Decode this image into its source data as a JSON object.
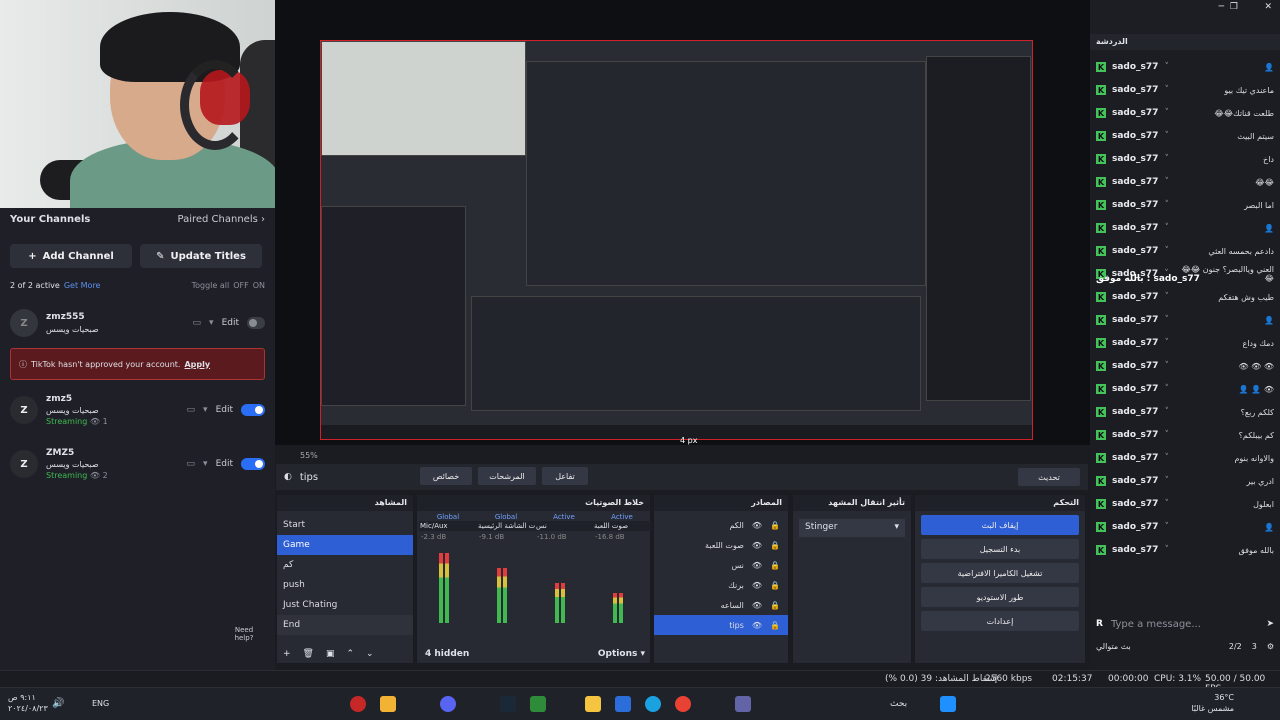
{
  "window_controls": {
    "minimize": "─",
    "restore": "❐",
    "close": "✕"
  },
  "left_panel": {
    "title": "Your Channels",
    "paired_link": "Paired Channels",
    "add_channel": "Add Channel",
    "update_titles": "Update Titles",
    "active_status": "2 of 2 active",
    "get_more": "Get More",
    "toggle_all": "Toggle all",
    "toggle_off": "OFF",
    "toggle_on": "ON",
    "channels": [
      {
        "name": "zmz555",
        "subtitle": "صبحيات ويسس",
        "edit": "Edit",
        "avatar": "Z",
        "enabled": false
      },
      {
        "name": "zmz5",
        "subtitle": "صبحيات ويسس",
        "edit": "Edit",
        "status": "Streaming",
        "viewers": "1",
        "enabled": true
      },
      {
        "name": "ZMZ5",
        "subtitle": "صبحيات ويسس",
        "edit": "Edit",
        "status": "Streaming",
        "viewers": "2",
        "enabled": true
      }
    ],
    "warning_text": "TikTok hasn't approved your account.",
    "warning_link": "Apply",
    "need_help": "Need help?"
  },
  "preview": {
    "zoom": "55%",
    "size_label": "4 px"
  },
  "toolbar": {
    "scene_name": "tips",
    "properties": "خصائص",
    "filters": "المرشحات",
    "interact": "تفاعل",
    "refresh": "تحديث"
  },
  "scenes_dock": {
    "title": "المشاهد",
    "items": [
      "Start",
      "Game",
      "كم",
      "push",
      "Just Chating",
      "End"
    ],
    "selected": "Game"
  },
  "mixer_dock": {
    "title": "خلاط الصوتيات",
    "channels": [
      {
        "tag": "Global",
        "name": "Mic/Aux",
        "db": "-2.3 dB"
      },
      {
        "tag": "Global",
        "name": "صوت الشاشة الرئيسية",
        "db": "-9.1 dB"
      },
      {
        "tag": "Active",
        "name": "نس",
        "db": "-11.0 dB"
      },
      {
        "tag": "Active",
        "name": "صوت اللعبة",
        "db": "-16.8 dB"
      }
    ],
    "hidden": "4 hidden",
    "options": "Options"
  },
  "sources_dock": {
    "title": "المصادر",
    "items": [
      "الكم",
      "صوت اللعبة",
      "نس",
      "برنك",
      "الساعه",
      "tips"
    ],
    "selected": "tips"
  },
  "transitions_dock": {
    "title": "تأثير انتقال المشهد",
    "value": "Stinger"
  },
  "controls_dock": {
    "title": "التحكم",
    "buttons": [
      "إيقاف البث",
      "بدء التسجيل",
      "تشغيل الكاميرا الافتراضية",
      "طور الاستوديو",
      "إعدادات"
    ]
  },
  "chat": {
    "title": "الدردشة",
    "messages": [
      {
        "user": "sado_s77",
        "msg": "👤"
      },
      {
        "user": "sado_s77",
        "msg": "ماعندي تيك بيو"
      },
      {
        "user": "sado_s77",
        "msg": "طلعت قناتك😂😂"
      },
      {
        "user": "sado_s77",
        "msg": "سيتم البيث"
      },
      {
        "user": "sado_s77",
        "msg": "داخ"
      },
      {
        "user": "sado_s77",
        "msg": "😂😂"
      },
      {
        "user": "sado_s77",
        "msg": "اما البصر"
      },
      {
        "user": "sado_s77",
        "msg": "👤"
      },
      {
        "user": "sado_s77",
        "msg": "دادعم بحمسه العثي"
      },
      {
        "user": "sado_s77",
        "msg": "العني وياالبصر؟ جنون 😂😂😂"
      },
      {
        "user": "sado_s77",
        "msg": "طيب وش هتفكم"
      },
      {
        "user": "sado_s77",
        "msg": "👤"
      },
      {
        "user": "sado_s77",
        "msg": "دمك وداع"
      },
      {
        "user": "sado_s77",
        "msg": "👁 👁 👁"
      },
      {
        "user": "sado_s77",
        "msg": "👁 👤 👤"
      },
      {
        "user": "sado_s77",
        "msg": "كلكم ربع؟"
      },
      {
        "user": "sado_s77",
        "msg": "كم بيبلكم؟"
      },
      {
        "user": "sado_s77",
        "msg": "والاوانه بنوم"
      },
      {
        "user": "sado_s77",
        "msg": "ادري بير"
      },
      {
        "user": "sado_s77",
        "msg": "ابعلول"
      },
      {
        "user": "sado_s77",
        "msg": "👤"
      },
      {
        "user": "sado_s77",
        "msg": "بالله موفق"
      }
    ],
    "highlight": "sado_s77 : بالله موفق",
    "input_placeholder": "Type a message...",
    "footer_label": "بث متوالي",
    "footer_ratio": "2/2",
    "footer_count": "3"
  },
  "status_bar": {
    "dropped": "إسقاط المشاهد: 39 (0.0 %)",
    "bitrate": "2560 kbps",
    "live_time": "02:15:37",
    "rec_time": "00:00:00",
    "cpu": "CPU: 3.1%",
    "fps": "50.00 / 50.00 FPS"
  },
  "taskbar": {
    "time": "٩:١١ ص",
    "date": "٢٠٢٤/٠٨/٢٣",
    "lang": "ENG",
    "search": "بحث",
    "weather_temp": "36°C",
    "weather_desc": "مشمس غالبًا"
  }
}
